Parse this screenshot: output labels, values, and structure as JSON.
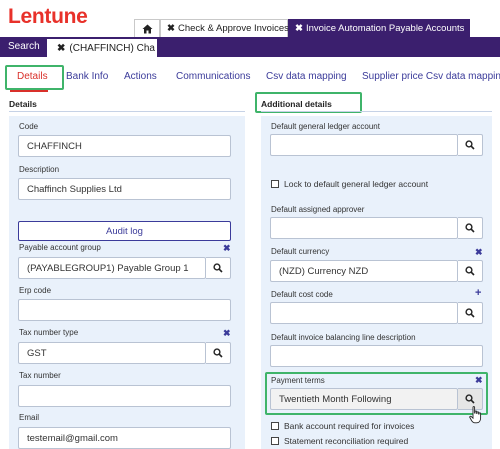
{
  "logo": "Lentune",
  "top_tabs": {
    "home_icon": "home-icon",
    "check_label": "Check & Approve Invoices",
    "active_label": "Invoice Automation Payable Accounts",
    "close_glyph": "✖"
  },
  "subbar": {
    "search_label": "Search",
    "record_tab_label": "(CHAFFINCH) Cha",
    "close_glyph": "✖"
  },
  "tabs": [
    "Details",
    "Bank Info",
    "Actions",
    "Communications",
    "Csv data mapping",
    "Supplier price Csv data mapping"
  ],
  "sections": {
    "left": "Details",
    "right": "Additional details"
  },
  "left_form": {
    "code_label": "Code",
    "code_value": "CHAFFINCH",
    "description_label": "Description",
    "description_value": "Chaffinch Supplies Ltd",
    "audit_log_label": "Audit log",
    "payable_group_label": "Payable account group",
    "payable_group_value": "(PAYABLEGROUP1) Payable Group 1",
    "erp_code_label": "Erp code",
    "erp_code_value": "",
    "tax_type_label": "Tax number type",
    "tax_type_value": "GST",
    "tax_number_label": "Tax number",
    "tax_number_value": "",
    "email_label": "Email",
    "email_value": "testemail@gmail.com"
  },
  "right_form": {
    "gl_account_label": "Default general ledger account",
    "gl_account_value": "",
    "lock_gl_label": "Lock to default general ledger account",
    "approver_label": "Default assigned approver",
    "approver_value": "",
    "currency_label": "Default currency",
    "currency_value": "(NZD) Currency NZD",
    "cost_code_label": "Default cost code",
    "cost_code_value": "",
    "balancing_label": "Default invoice balancing line description",
    "balancing_value": "",
    "payment_terms_label": "Payment terms",
    "payment_terms_value": "Twentieth Month Following",
    "bank_required_label": "Bank account required for invoices",
    "statement_required_label": "Statement reconciliation required"
  },
  "glyphs": {
    "clear": "✖",
    "add": "+"
  },
  "colors": {
    "brand_red": "#e8312a",
    "nav_purple": "#3b1f6e",
    "link_blue": "#3b3b9a",
    "highlight_green": "#3fb46a",
    "panel_bg": "#e9f1fb"
  }
}
